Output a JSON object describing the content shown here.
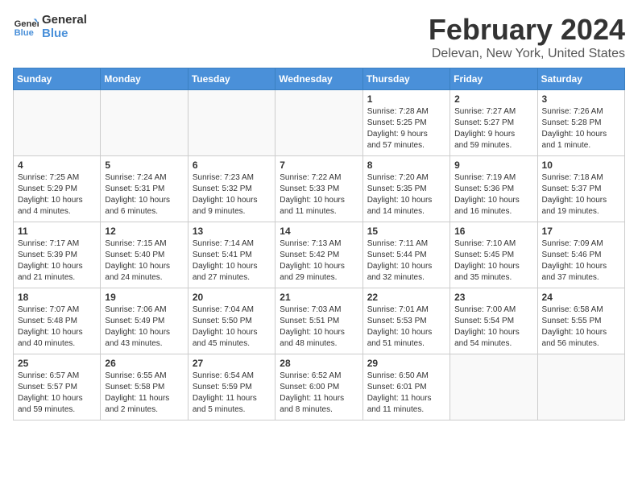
{
  "logo": {
    "line1": "General",
    "line2": "Blue"
  },
  "title": "February 2024",
  "subtitle": "Delevan, New York, United States",
  "days_of_week": [
    "Sunday",
    "Monday",
    "Tuesday",
    "Wednesday",
    "Thursday",
    "Friday",
    "Saturday"
  ],
  "weeks": [
    [
      {
        "day": "",
        "info": ""
      },
      {
        "day": "",
        "info": ""
      },
      {
        "day": "",
        "info": ""
      },
      {
        "day": "",
        "info": ""
      },
      {
        "day": "1",
        "info": "Sunrise: 7:28 AM\nSunset: 5:25 PM\nDaylight: 9 hours\nand 57 minutes."
      },
      {
        "day": "2",
        "info": "Sunrise: 7:27 AM\nSunset: 5:27 PM\nDaylight: 9 hours\nand 59 minutes."
      },
      {
        "day": "3",
        "info": "Sunrise: 7:26 AM\nSunset: 5:28 PM\nDaylight: 10 hours\nand 1 minute."
      }
    ],
    [
      {
        "day": "4",
        "info": "Sunrise: 7:25 AM\nSunset: 5:29 PM\nDaylight: 10 hours\nand 4 minutes."
      },
      {
        "day": "5",
        "info": "Sunrise: 7:24 AM\nSunset: 5:31 PM\nDaylight: 10 hours\nand 6 minutes."
      },
      {
        "day": "6",
        "info": "Sunrise: 7:23 AM\nSunset: 5:32 PM\nDaylight: 10 hours\nand 9 minutes."
      },
      {
        "day": "7",
        "info": "Sunrise: 7:22 AM\nSunset: 5:33 PM\nDaylight: 10 hours\nand 11 minutes."
      },
      {
        "day": "8",
        "info": "Sunrise: 7:20 AM\nSunset: 5:35 PM\nDaylight: 10 hours\nand 14 minutes."
      },
      {
        "day": "9",
        "info": "Sunrise: 7:19 AM\nSunset: 5:36 PM\nDaylight: 10 hours\nand 16 minutes."
      },
      {
        "day": "10",
        "info": "Sunrise: 7:18 AM\nSunset: 5:37 PM\nDaylight: 10 hours\nand 19 minutes."
      }
    ],
    [
      {
        "day": "11",
        "info": "Sunrise: 7:17 AM\nSunset: 5:39 PM\nDaylight: 10 hours\nand 21 minutes."
      },
      {
        "day": "12",
        "info": "Sunrise: 7:15 AM\nSunset: 5:40 PM\nDaylight: 10 hours\nand 24 minutes."
      },
      {
        "day": "13",
        "info": "Sunrise: 7:14 AM\nSunset: 5:41 PM\nDaylight: 10 hours\nand 27 minutes."
      },
      {
        "day": "14",
        "info": "Sunrise: 7:13 AM\nSunset: 5:42 PM\nDaylight: 10 hours\nand 29 minutes."
      },
      {
        "day": "15",
        "info": "Sunrise: 7:11 AM\nSunset: 5:44 PM\nDaylight: 10 hours\nand 32 minutes."
      },
      {
        "day": "16",
        "info": "Sunrise: 7:10 AM\nSunset: 5:45 PM\nDaylight: 10 hours\nand 35 minutes."
      },
      {
        "day": "17",
        "info": "Sunrise: 7:09 AM\nSunset: 5:46 PM\nDaylight: 10 hours\nand 37 minutes."
      }
    ],
    [
      {
        "day": "18",
        "info": "Sunrise: 7:07 AM\nSunset: 5:48 PM\nDaylight: 10 hours\nand 40 minutes."
      },
      {
        "day": "19",
        "info": "Sunrise: 7:06 AM\nSunset: 5:49 PM\nDaylight: 10 hours\nand 43 minutes."
      },
      {
        "day": "20",
        "info": "Sunrise: 7:04 AM\nSunset: 5:50 PM\nDaylight: 10 hours\nand 45 minutes."
      },
      {
        "day": "21",
        "info": "Sunrise: 7:03 AM\nSunset: 5:51 PM\nDaylight: 10 hours\nand 48 minutes."
      },
      {
        "day": "22",
        "info": "Sunrise: 7:01 AM\nSunset: 5:53 PM\nDaylight: 10 hours\nand 51 minutes."
      },
      {
        "day": "23",
        "info": "Sunrise: 7:00 AM\nSunset: 5:54 PM\nDaylight: 10 hours\nand 54 minutes."
      },
      {
        "day": "24",
        "info": "Sunrise: 6:58 AM\nSunset: 5:55 PM\nDaylight: 10 hours\nand 56 minutes."
      }
    ],
    [
      {
        "day": "25",
        "info": "Sunrise: 6:57 AM\nSunset: 5:57 PM\nDaylight: 10 hours\nand 59 minutes."
      },
      {
        "day": "26",
        "info": "Sunrise: 6:55 AM\nSunset: 5:58 PM\nDaylight: 11 hours\nand 2 minutes."
      },
      {
        "day": "27",
        "info": "Sunrise: 6:54 AM\nSunset: 5:59 PM\nDaylight: 11 hours\nand 5 minutes."
      },
      {
        "day": "28",
        "info": "Sunrise: 6:52 AM\nSunset: 6:00 PM\nDaylight: 11 hours\nand 8 minutes."
      },
      {
        "day": "29",
        "info": "Sunrise: 6:50 AM\nSunset: 6:01 PM\nDaylight: 11 hours\nand 11 minutes."
      },
      {
        "day": "",
        "info": ""
      },
      {
        "day": "",
        "info": ""
      }
    ]
  ]
}
